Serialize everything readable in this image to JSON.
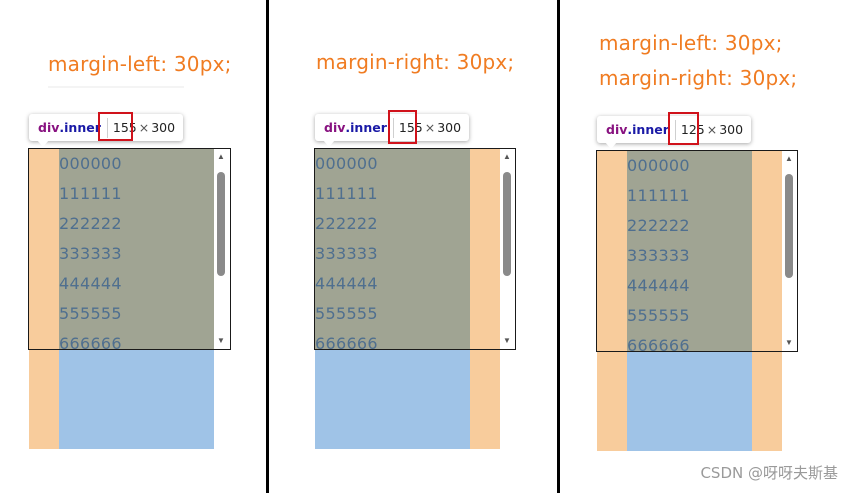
{
  "panels": [
    {
      "captions": [
        "margin-left: 30px;"
      ],
      "tooltip": {
        "tag": "div",
        "cls": ".inner",
        "width": "155",
        "times": "×",
        "height": "300"
      },
      "lines": [
        "000000",
        "111111",
        "222222",
        "333333",
        "444444",
        "555555",
        "666666"
      ]
    },
    {
      "captions": [
        "margin-right: 30px;"
      ],
      "tooltip": {
        "tag": "div",
        "cls": ".inner",
        "width": "155",
        "times": "×",
        "height": "300"
      },
      "lines": [
        "000000",
        "111111",
        "222222",
        "333333",
        "444444",
        "555555",
        "666666"
      ]
    },
    {
      "captions": [
        "margin-left: 30px;",
        "margin-right: 30px;"
      ],
      "tooltip": {
        "tag": "div",
        "cls": ".inner",
        "width": "125",
        "times": "×",
        "height": "300"
      },
      "lines": [
        "000000",
        "111111",
        "222222",
        "333333",
        "444444",
        "555555",
        "666666"
      ]
    }
  ],
  "scrollbar": {
    "up_icon": "▲",
    "down_icon": "▼"
  },
  "watermark": "CSDN @呀呀夫斯基",
  "colors": {
    "caption": "#f07c22",
    "margin": "#f8cc9c",
    "content": "#9fc3e7",
    "highlight": "#a0a493",
    "text": "#4f6f8f",
    "redbox": "#d0121b"
  }
}
